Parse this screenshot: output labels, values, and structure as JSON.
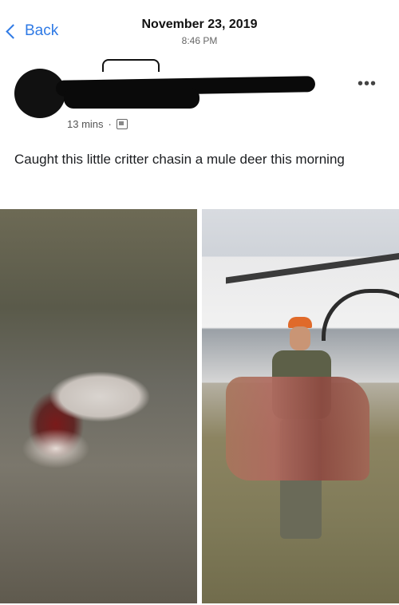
{
  "header": {
    "back_label": "Back",
    "date": "November 23, 2019",
    "time": "8:46 PM"
  },
  "post": {
    "timestamp": "13 mins",
    "separator": "·",
    "more_icon": "ellipsis-icon",
    "privacy_icon": "friends-privacy-icon",
    "caption": "Caught this little critter chasin a mule deer this morning",
    "photos": [
      {
        "name": "photo-left",
        "icon": "wolf-photo"
      },
      {
        "name": "photo-right",
        "icon": "hunter-photo"
      }
    ]
  },
  "colors": {
    "accent": "#2f7ae5",
    "text": "#1c1e21",
    "secondary": "#666666"
  }
}
